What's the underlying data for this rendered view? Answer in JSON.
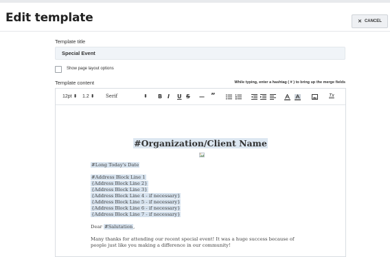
{
  "header": {
    "title": "Edit template",
    "cancel_label": "CANCEL"
  },
  "form": {
    "title_label": "Template title",
    "title_value": "Special Event",
    "layout_checkbox_label": "Show page layout options",
    "layout_checked": false,
    "content_label": "Template content",
    "hint": "While typing, enter a hashtag ( # ) to bring up the merge fields"
  },
  "toolbar": {
    "font_size": "12pt",
    "line_height": "1.2",
    "font_family": "Serif",
    "bold": "B",
    "italic": "I",
    "underline": "U",
    "strike": "S",
    "hr": "—",
    "quote": "”",
    "clear": "Tx"
  },
  "document": {
    "org_name": "#Organization/Client Name",
    "date_field": "#Long Today's Date",
    "address_lines": [
      "#Address Block Line 1",
      "{Address Block Line 2}",
      "{Address Block Line 3}",
      "{Address Block Line 4 - if necessary}",
      "{Address Block Line 5 - if necessary}",
      "{Address Block Line 6 - if necessary}",
      "{Address Block Line 7 - if necessary}"
    ],
    "dear": "Dear",
    "salutation": "#Salutation",
    "salutation_suffix": ",",
    "body_line_1": "Many thanks for attending our recent special event! It was a huge success because of",
    "body_line_2": "people just like you making a difference in our community!"
  },
  "colors": {
    "merge_highlight": "#d6e2ee",
    "input_bg": "#f0f4f8"
  }
}
